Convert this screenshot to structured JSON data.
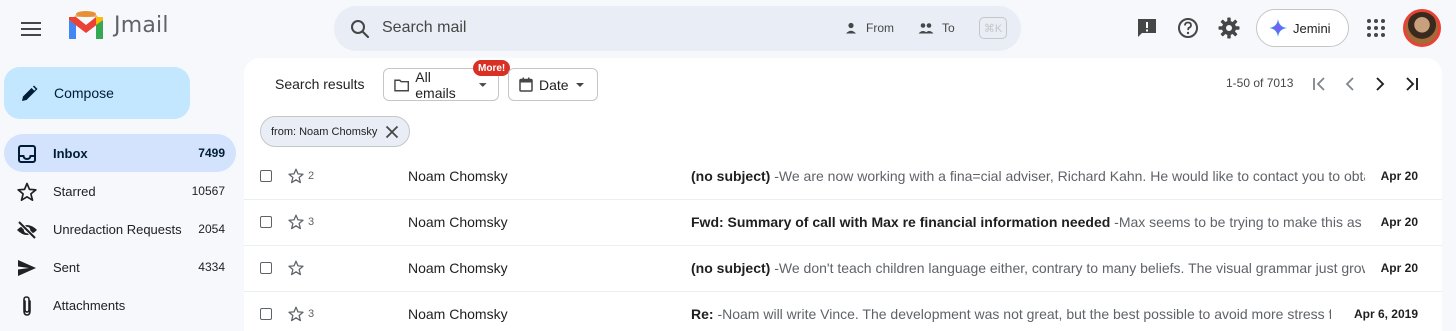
{
  "header": {
    "app_name": "Jmail",
    "search_placeholder": "Search mail",
    "from_label": "From",
    "to_label": "To",
    "shortcut": "⌘K",
    "assistant_label": "Jemini"
  },
  "sidebar": {
    "compose_label": "Compose",
    "items": [
      {
        "label": "Inbox",
        "count": "7499",
        "icon": "inbox-icon"
      },
      {
        "label": "Starred",
        "count": "10567",
        "icon": "star-icon"
      },
      {
        "label": "Unredaction Requests",
        "count": "2054",
        "icon": "eye-off-icon"
      },
      {
        "label": "Sent",
        "count": "4334",
        "icon": "send-icon"
      },
      {
        "label": "Attachments",
        "count": "",
        "icon": "paperclip-icon"
      }
    ]
  },
  "toolbar": {
    "results_label": "Search results",
    "all_emails_label": "All emails",
    "more_badge": "More!",
    "date_label": "Date",
    "pager_text": "1-50 of 7013",
    "active_filter": "from: Noam Chomsky"
  },
  "emails": [
    {
      "thread_count": "2",
      "sender": "Noam Chomsky",
      "subject": "(no subject)",
      "snippet": " -We are now working with a fina=cial adviser, Richard Kahn. He would like to contact you to obtain a=",
      "date": "Apr 20"
    },
    {
      "thread_count": "3",
      "sender": "Noam Chomsky",
      "subject": "Fwd: Summary of call with Max re financial information needed",
      "snippet": " -Max seems to be trying to make this as difficult a",
      "date": "Apr 20"
    },
    {
      "thread_count": "",
      "sender": "Noam Chomsky",
      "subject": "(no subject)",
      "snippet": " -We don't teach children language either, contrary to many beliefs. The visual grammar just grows, an",
      "date": "Apr 20"
    },
    {
      "thread_count": "3",
      "sender": "Noam Chomsky",
      "subject": "Re:",
      "snippet": " -Noam will write Vince. The development was not great, but the best possible to avoid more stress for",
      "date": "Apr 6, 2019"
    }
  ],
  "colors": {
    "compose_bg": "#c2e7ff",
    "active_nav": "#d3e3fd",
    "badge": "#d93025"
  }
}
